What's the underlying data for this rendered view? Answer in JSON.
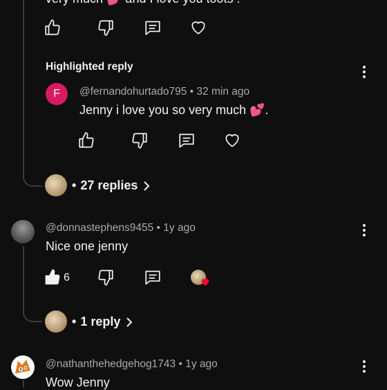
{
  "top_comment": {
    "text": "very much 💕 and I love you toots !"
  },
  "highlighted": {
    "label": "Highlighted reply",
    "avatar_letter": "F",
    "author": "@fernandohurtado795",
    "time": "32 min ago",
    "text": "Jenny i love you so very much 💕."
  },
  "replies_1": {
    "label": "27 replies"
  },
  "comment_2": {
    "author": "@donnastephens9455",
    "time": "1y ago",
    "text": "Nice one jenny",
    "likes": "6"
  },
  "replies_2": {
    "label": "1 reply"
  },
  "comment_3": {
    "author": "@nathanthehedgehog1743",
    "time": "1y ago",
    "text": "Wow Jenny"
  },
  "meta": {
    "separator": "•"
  },
  "colors": {
    "background": "#0f0f0f",
    "text": "#f1f1f1",
    "secondary": "#aaaaaa",
    "avatar_f": "#d81b60",
    "heart_badge": "#ff0033"
  }
}
